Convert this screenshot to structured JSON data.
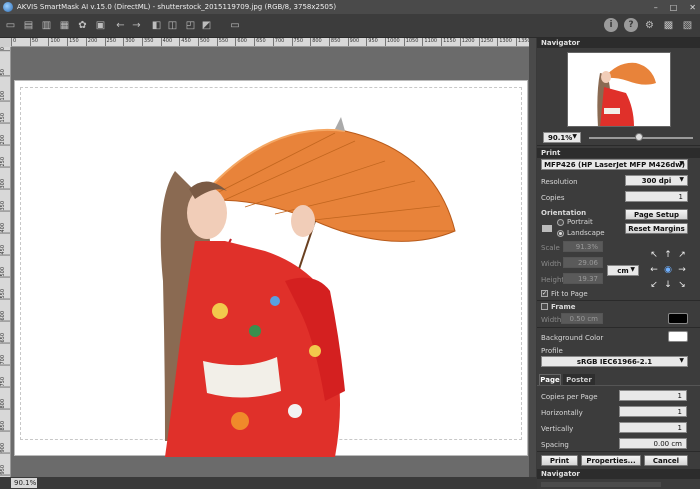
{
  "window": {
    "title": "AKVIS SmartMask AI v.15.0 (DirectML) - shutterstock_2015119709.jpg (RGB/8, 3758x2505)",
    "controls": [
      "–",
      "□",
      "✕"
    ]
  },
  "status": {
    "zoom": "90.1%"
  },
  "navigator": {
    "header": "Navigator",
    "zoom_value": "90.1%",
    "footer_header": "Navigator"
  },
  "print": {
    "header": "Print",
    "printer": "MFP426 (HP LaserJet MFP M426dw)",
    "resolution_label": "Resolution",
    "resolution_value": "300 dpi",
    "copies_label": "Copies",
    "copies_value": "1",
    "orientation_label": "Orientation",
    "portrait_label": "Portrait",
    "landscape_label": "Landscape",
    "page_setup_button": "Page Setup",
    "reset_margins_button": "Reset Margins",
    "scale_label": "Scale",
    "scale_value": "91.3%",
    "width_label": "Width",
    "width_value": "29.06",
    "height_label": "Height",
    "height_value": "19.37",
    "unit_value": "cm",
    "fit_to_page_label": "Fit to Page",
    "frame_label": "Frame",
    "frame_width_label": "Width",
    "frame_width_value": "0.50 cm",
    "background_color_label": "Background Color",
    "profile_label": "Profile",
    "profile_value": "sRGB IEC61966-2.1",
    "tab_page": "Page",
    "tab_poster": "Poster",
    "copies_per_page_label": "Copies per Page",
    "copies_per_page_value": "1",
    "horizontally_label": "Horizontally",
    "horizontally_value": "1",
    "vertically_label": "Vertically",
    "vertically_value": "1",
    "spacing_label": "Spacing",
    "spacing_value": "0.00 cm",
    "print_button": "Print",
    "properties_button": "Properties...",
    "cancel_button": "Cancel"
  },
  "rulers": {
    "top": [
      "0",
      "50",
      "100",
      "150",
      "200",
      "250",
      "300",
      "350",
      "400",
      "450",
      "500",
      "550",
      "600",
      "650",
      "700",
      "750",
      "800",
      "850",
      "900",
      "950",
      "1000",
      "1050",
      "1100",
      "1150",
      "1200",
      "1250",
      "1300",
      "1350",
      "1400"
    ],
    "left": [
      "0",
      "50",
      "100",
      "150",
      "200",
      "250",
      "300",
      "350",
      "400",
      "450",
      "500",
      "550",
      "600",
      "650",
      "700",
      "750",
      "800",
      "850",
      "900",
      "950"
    ]
  },
  "colors": {
    "frame_swatch": "#000000",
    "background_swatch": "#ffffff",
    "parasol": "#e8833a",
    "kimono": "#e0302a"
  }
}
